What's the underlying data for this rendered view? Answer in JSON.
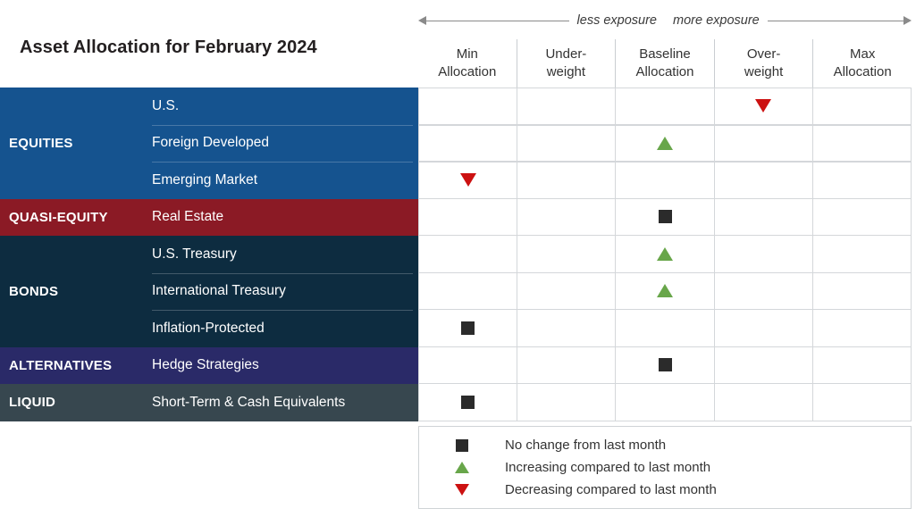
{
  "title": "Asset Allocation for February 2024",
  "exposure": {
    "less_label": "less exposure",
    "more_label": "more exposure"
  },
  "columns": [
    "Min\nAllocation",
    "Under-\nweight",
    "Baseline\nAllocation",
    "Over-\nweight",
    "Max\nAllocation"
  ],
  "column_lines": [
    [
      "Min",
      "Allocation"
    ],
    [
      "Under-",
      "weight"
    ],
    [
      "Baseline",
      "Allocation"
    ],
    [
      "Over-",
      "weight"
    ],
    [
      "Max",
      "Allocation"
    ]
  ],
  "colors": {
    "equities": "#15538f",
    "quasi_equity": "#8b1a25",
    "bonds": "#0d2c40",
    "alternatives": "#2a2a68",
    "liquid": "#37474f",
    "no_change": "#2b2b2b",
    "increasing": "#68a64a",
    "decreasing": "#cc1111",
    "grid": "#d4d7da"
  },
  "groups": [
    {
      "label": "EQUITIES",
      "color_key": "equities",
      "rows": [
        {
          "name": "U.S.",
          "marker": "down",
          "column": 3
        },
        {
          "name": "Foreign Developed",
          "marker": "up",
          "column": 2
        },
        {
          "name": "Emerging Market",
          "marker": "down",
          "column": 0
        }
      ]
    },
    {
      "label": "QUASI-EQUITY",
      "color_key": "quasi_equity",
      "rows": [
        {
          "name": "Real Estate",
          "marker": "square",
          "column": 2
        }
      ]
    },
    {
      "label": "BONDS",
      "color_key": "bonds",
      "rows": [
        {
          "name": "U.S. Treasury",
          "marker": "up",
          "column": 2
        },
        {
          "name": "International Treasury",
          "marker": "up",
          "column": 2
        },
        {
          "name": "Inflation-Protected",
          "marker": "square",
          "column": 0
        }
      ]
    },
    {
      "label": "ALTERNATIVES",
      "color_key": "alternatives",
      "rows": [
        {
          "name": "Hedge Strategies",
          "marker": "square",
          "column": 2
        }
      ]
    },
    {
      "label": "LIQUID",
      "color_key": "liquid",
      "rows": [
        {
          "name": "Short-Term & Cash Equivalents",
          "marker": "square",
          "column": 0
        }
      ]
    }
  ],
  "legend": [
    {
      "marker": "square",
      "text": "No change from last month"
    },
    {
      "marker": "up",
      "text": "Increasing compared to last month"
    },
    {
      "marker": "down",
      "text": "Decreasing compared to last month"
    }
  ],
  "chart_data": {
    "type": "table",
    "title": "Asset Allocation for February 2024",
    "xlabel": "",
    "ylabel": "",
    "categories": [
      "Min Allocation",
      "Under-weight",
      "Baseline Allocation",
      "Over-weight",
      "Max Allocation"
    ],
    "annotations": [
      "less exposure",
      "more exposure"
    ],
    "legend_position": "bottom-right",
    "grid": true,
    "rows": [
      {
        "group": "EQUITIES",
        "asset": "U.S.",
        "position": "Over-weight",
        "change": "decreasing"
      },
      {
        "group": "EQUITIES",
        "asset": "Foreign Developed",
        "position": "Baseline Allocation",
        "change": "increasing"
      },
      {
        "group": "EQUITIES",
        "asset": "Emerging Market",
        "position": "Min Allocation",
        "change": "decreasing"
      },
      {
        "group": "QUASI-EQUITY",
        "asset": "Real Estate",
        "position": "Baseline Allocation",
        "change": "no change"
      },
      {
        "group": "BONDS",
        "asset": "U.S. Treasury",
        "position": "Baseline Allocation",
        "change": "increasing"
      },
      {
        "group": "BONDS",
        "asset": "International Treasury",
        "position": "Baseline Allocation",
        "change": "increasing"
      },
      {
        "group": "BONDS",
        "asset": "Inflation-Protected",
        "position": "Min Allocation",
        "change": "no change"
      },
      {
        "group": "ALTERNATIVES",
        "asset": "Hedge Strategies",
        "position": "Baseline Allocation",
        "change": "no change"
      },
      {
        "group": "LIQUID",
        "asset": "Short-Term & Cash Equivalents",
        "position": "Min Allocation",
        "change": "no change"
      }
    ]
  }
}
